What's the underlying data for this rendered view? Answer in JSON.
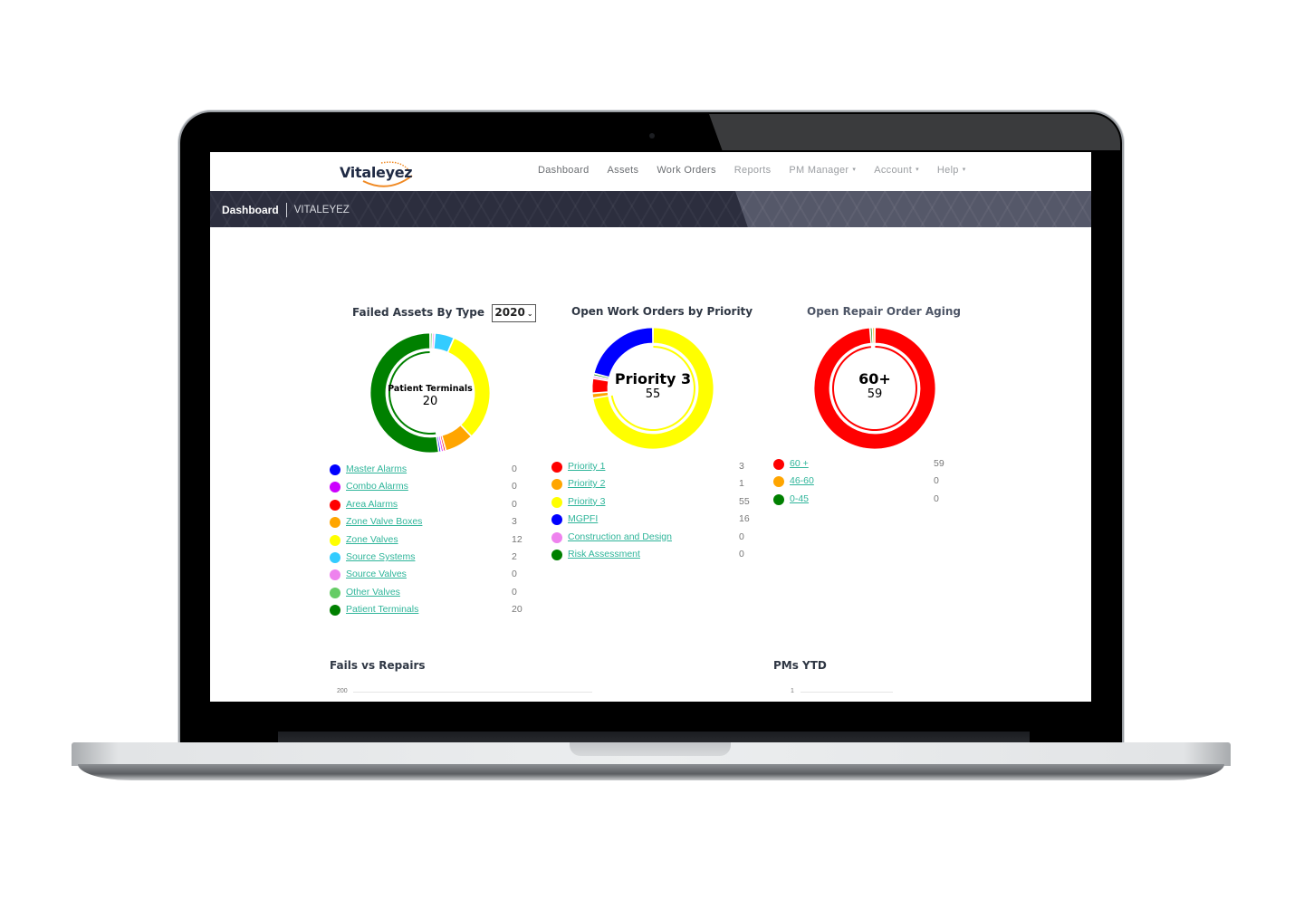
{
  "app": {
    "logo": "Vitaleyez"
  },
  "nav": {
    "items": [
      {
        "label": "Dashboard",
        "dropdown": false
      },
      {
        "label": "Assets",
        "dropdown": false
      },
      {
        "label": "Work Orders",
        "dropdown": false
      },
      {
        "label": "Reports",
        "dropdown": false
      },
      {
        "label": "PM Manager",
        "dropdown": true
      },
      {
        "label": "Account",
        "dropdown": true
      },
      {
        "label": "Help",
        "dropdown": true
      }
    ],
    "caret": "▾"
  },
  "breadcrumb": {
    "page": "Dashboard",
    "org": "VITALEYEZ"
  },
  "failed_assets": {
    "title": "Failed Assets By Type",
    "year": "2020",
    "center_label": "Patient Terminals",
    "center_value": "20",
    "items": [
      {
        "label": "Master Alarms",
        "value": 0,
        "color": "#0000ff"
      },
      {
        "label": "Combo Alarms",
        "value": 0,
        "color": "#cc00ff"
      },
      {
        "label": "Area Alarms",
        "value": 0,
        "color": "#ff0000"
      },
      {
        "label": "Zone Valve Boxes",
        "value": 3,
        "color": "#ffa500"
      },
      {
        "label": "Zone Valves",
        "value": 12,
        "color": "#ffff00"
      },
      {
        "label": "Source Systems",
        "value": 2,
        "color": "#33ccff"
      },
      {
        "label": "Source Valves",
        "value": 0,
        "color": "#ee82ee"
      },
      {
        "label": "Other Valves",
        "value": 0,
        "color": "#66cc66"
      },
      {
        "label": "Patient Terminals",
        "value": 20,
        "color": "#008000"
      }
    ]
  },
  "work_orders": {
    "title": "Open Work Orders by Priority",
    "center_label": "Priority 3",
    "center_value": "55",
    "items": [
      {
        "label": "Priority 1",
        "value": 3,
        "color": "#ff0000"
      },
      {
        "label": "Priority 2",
        "value": 1,
        "color": "#ffa500"
      },
      {
        "label": "Priority 3",
        "value": 55,
        "color": "#ffff00"
      },
      {
        "label": "MGPFI",
        "value": 16,
        "color": "#0000ff"
      },
      {
        "label": "Construction and Design",
        "value": 0,
        "color": "#ee82ee"
      },
      {
        "label": "Risk Assessment",
        "value": 0,
        "color": "#008000"
      }
    ]
  },
  "repair_aging": {
    "title": "Open Repair Order Aging",
    "center_label": "60+",
    "center_value": "59",
    "items": [
      {
        "label": "60 +",
        "value": 59,
        "color": "#ff0000"
      },
      {
        "label": "46-60",
        "value": 0,
        "color": "#ffa500"
      },
      {
        "label": "0-45",
        "value": 0,
        "color": "#008000"
      }
    ]
  },
  "fails_vs_repairs": {
    "title": "Fails vs Repairs",
    "top_tick": "200"
  },
  "pms_ytd": {
    "title": "PMs YTD",
    "top_tick": "1"
  }
}
